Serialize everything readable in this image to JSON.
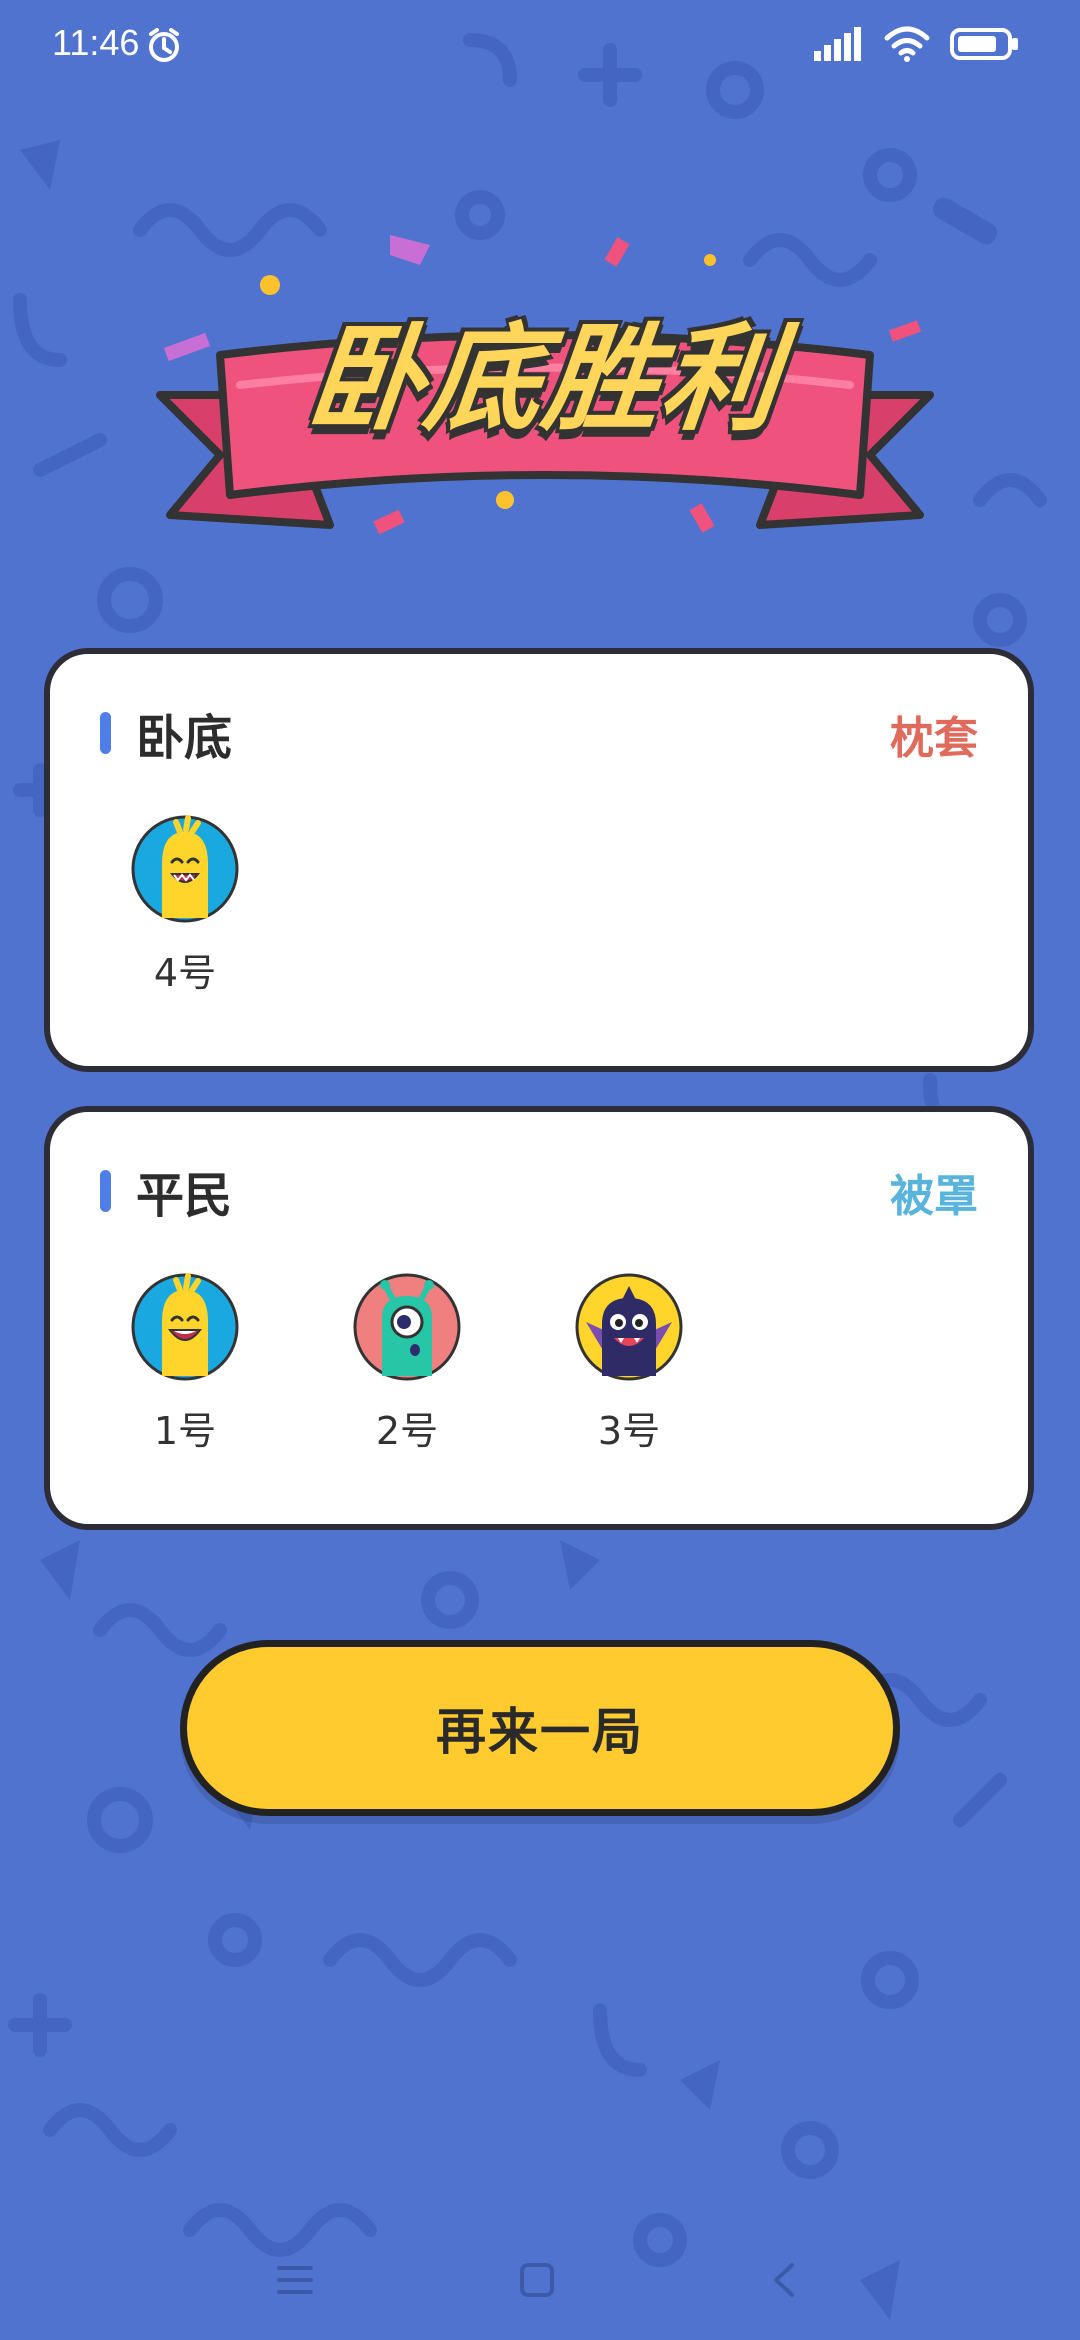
{
  "status_bar": {
    "time": "11:46",
    "icons": [
      "alarm-icon",
      "signal-icon",
      "wifi-icon",
      "battery-icon"
    ]
  },
  "result": {
    "title": "卧底胜利"
  },
  "groups": [
    {
      "title": "卧底",
      "word": "枕套",
      "word_color": "#e06a5b",
      "players": [
        {
          "label": "4号",
          "avatar": "yellow-monster-icon"
        }
      ]
    },
    {
      "title": "平民",
      "word": "被罩",
      "word_color": "#59b4dd",
      "players": [
        {
          "label": "1号",
          "avatar": "yellow-monster-icon"
        },
        {
          "label": "2号",
          "avatar": "green-alien-icon"
        },
        {
          "label": "3号",
          "avatar": "purple-bat-monster-icon"
        }
      ]
    }
  ],
  "actions": {
    "replay_label": "再来一局"
  },
  "nav": [
    "menu-icon",
    "home-icon",
    "back-icon"
  ],
  "colors": {
    "background": "#5073d0",
    "banner_ribbon": "#f0527e",
    "title_text": "#ffd65a",
    "button": "#ffcb2f",
    "accent_bar": "#4f7ee9"
  }
}
